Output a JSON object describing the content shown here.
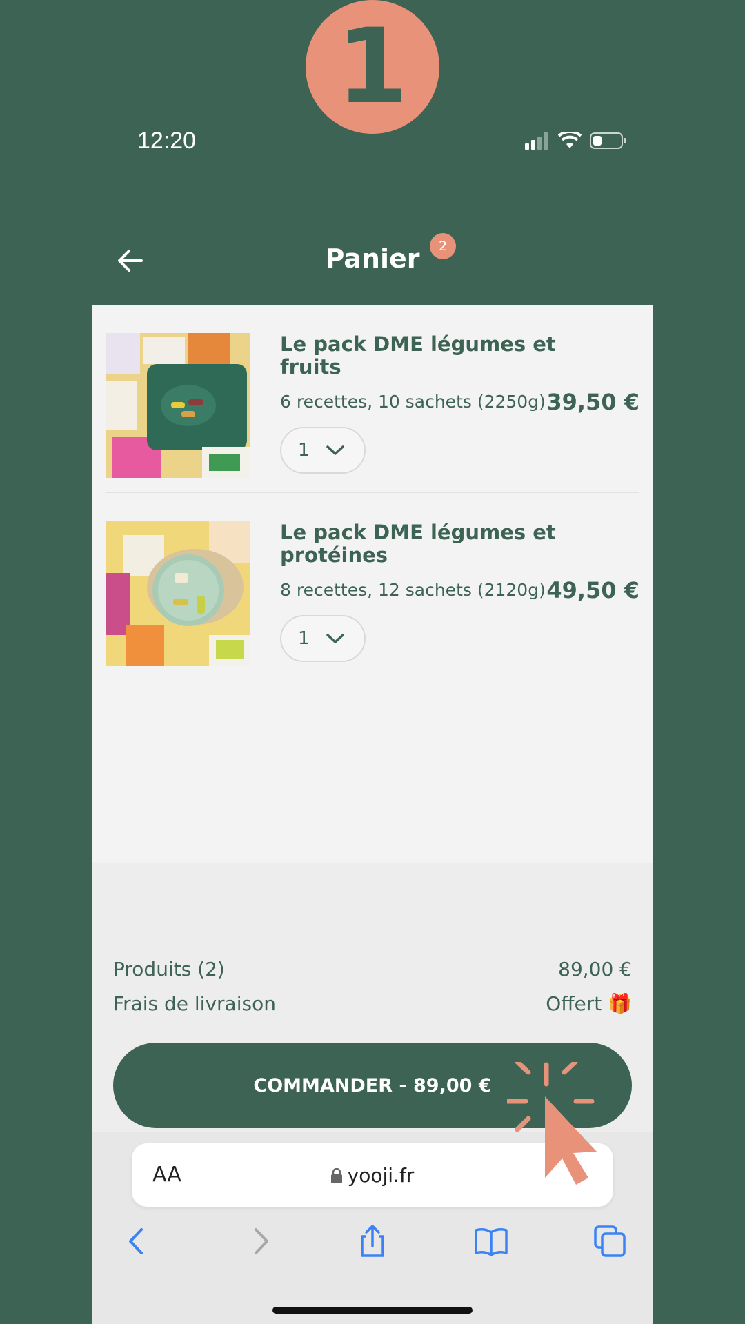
{
  "step_number": "1",
  "status_bar": {
    "time": "12:20"
  },
  "header": {
    "title": "Panier",
    "badge_count": "2"
  },
  "cart_items": [
    {
      "name": "Le pack DME légumes et fruits",
      "description": "6 recettes, 10 sachets (2250g)",
      "price": "39,50 €",
      "quantity": "1"
    },
    {
      "name": "Le pack DME légumes et protéines",
      "description": "8 recettes, 12 sachets (2120g)",
      "price": "49,50 €",
      "quantity": "1"
    }
  ],
  "summary": {
    "products_label": "Produits (2)",
    "products_value": "89,00 €",
    "shipping_label": "Frais de livraison",
    "shipping_value": "Offert 🎁"
  },
  "checkout_button": "COMMANDER - 89,00 €",
  "browser": {
    "text_size_label": "AA",
    "url": "yooji.fr"
  },
  "colors": {
    "brand_green": "#3d6354",
    "accent_salmon": "#e8927a",
    "page_bg": "#f4f3f3"
  }
}
